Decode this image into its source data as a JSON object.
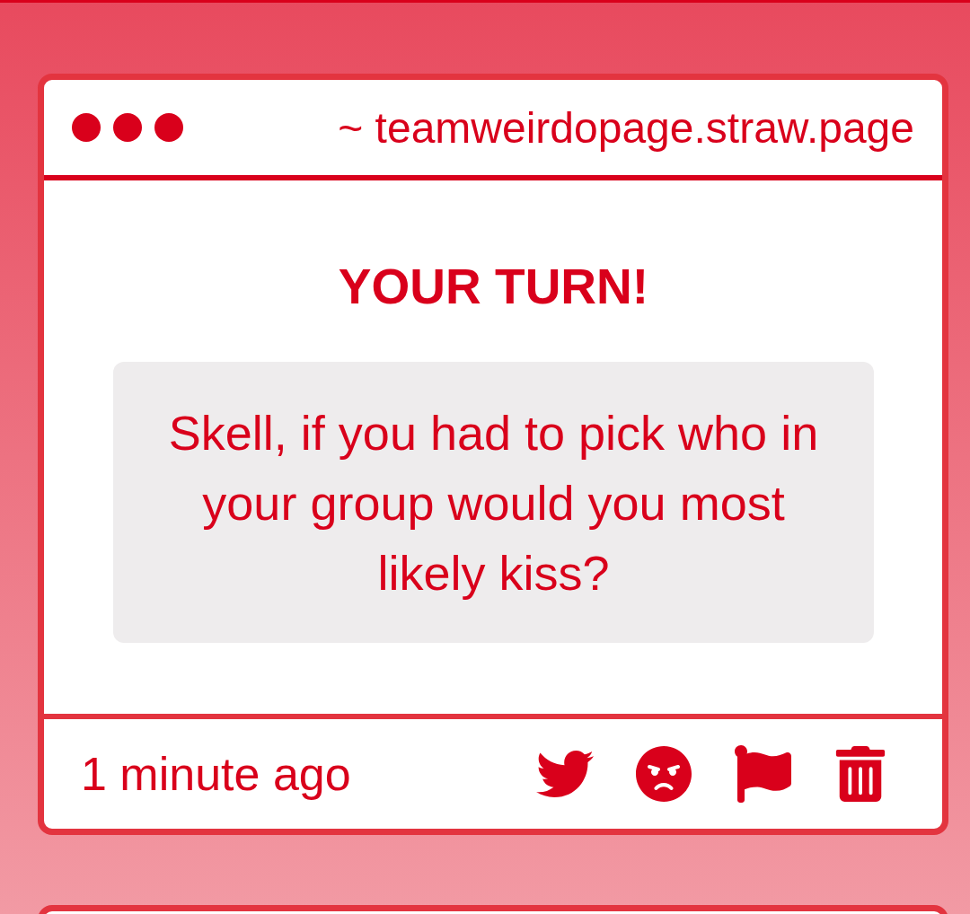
{
  "window": {
    "url": "~ teamweirdopage.straw.page"
  },
  "card": {
    "heading": "YOUR TURN!",
    "question": "Skell, if you had to pick who in your group would you most likely kiss?",
    "time": "1 minute ago",
    "actions": [
      {
        "kind": "share"
      },
      {
        "kind": "angry"
      },
      {
        "kind": "flag"
      },
      {
        "kind": "delete"
      }
    ]
  }
}
